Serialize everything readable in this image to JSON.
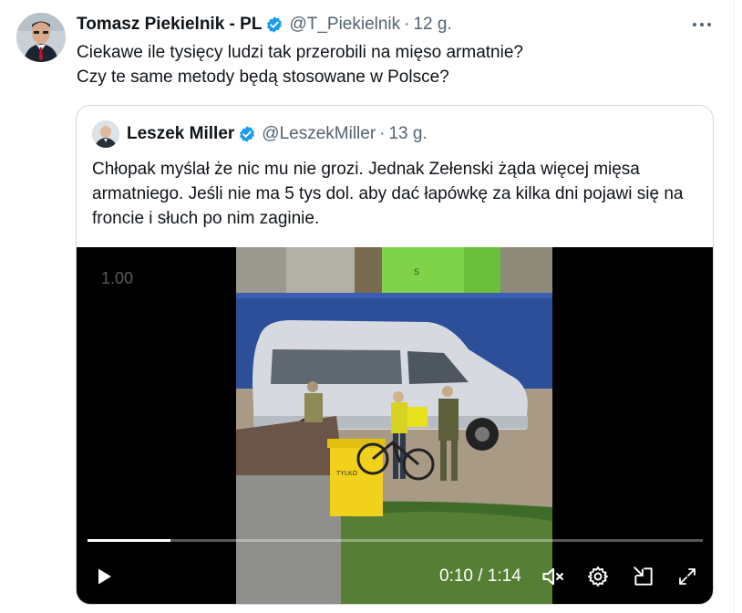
{
  "tweet": {
    "author_name": "Tomasz Piekielnik - PL",
    "handle": "@T_Piekielnik",
    "separator": "·",
    "time": "12 g.",
    "lines": [
      "Ciekawe ile tysięcy ludzi tak przerobili na mięso armatnie?",
      "Czy te same metody będą stosowane w Polsce?"
    ]
  },
  "quoted": {
    "author_name": "Leszek Miller",
    "handle": "@LeszekMiller",
    "separator": "·",
    "time": "13 g.",
    "text": "Chłopak myślał że nic mu nie grozi. Jednak Zełenski żąda więcej mięsa armatniego. Jeśli nie ma 5 tys dol. aby dać łapówkę za kilka dni pojawi się na froncie i słuch po nim zaginie."
  },
  "video": {
    "speed_label": "1.00",
    "progress_fraction": 0.135,
    "time_readout": "0:10 / 1:14"
  },
  "icons": {
    "verified": "verified-badge-icon",
    "more": "more-horizontal-icon",
    "play": "play-icon",
    "mute": "volume-muted-icon",
    "settings": "gear-icon",
    "pip": "picture-in-picture-icon",
    "fullscreen": "fullscreen-icon"
  },
  "colors": {
    "accent": "#1d9bf0",
    "text": "#0f1419",
    "muted": "#536471",
    "border": "#cfd9de"
  }
}
